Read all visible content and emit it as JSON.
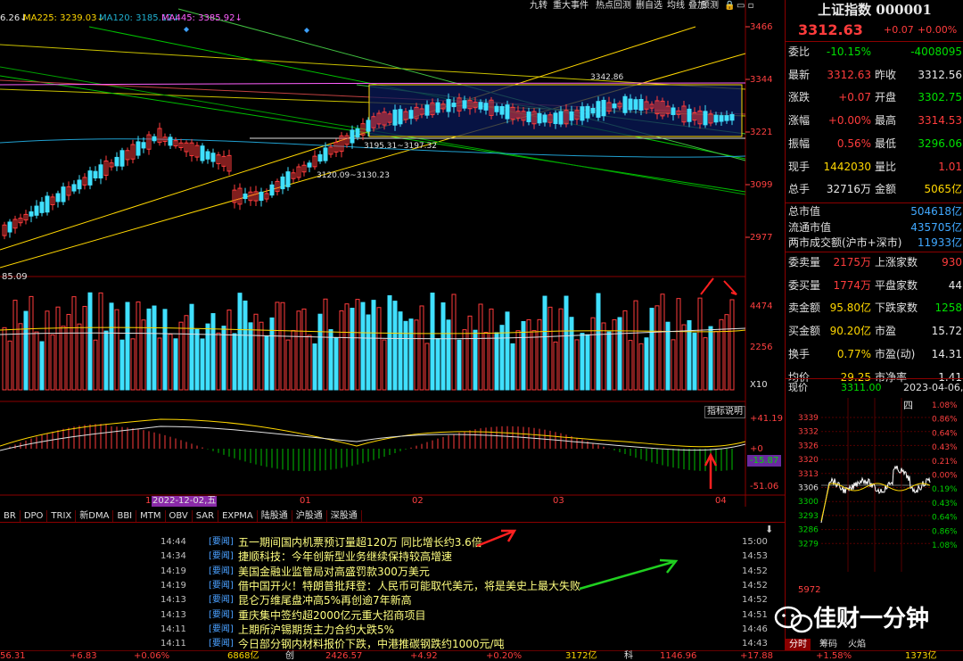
{
  "toolbar": {
    "buttons": [
      "九转",
      "重大事件",
      "热点回测",
      "删自选",
      "均线",
      "叠加",
      "预测"
    ]
  },
  "ma_legend": {
    "ma_first": "6.26↓",
    "ma225": "MA225: 3239.03↓",
    "ma120": "MA120: 3185.12↓",
    "ma445": "MA445: 3385.92↓"
  },
  "price_axis": [
    "3466",
    "3344",
    "3221",
    "3099",
    "2977"
  ],
  "annotations": {
    "high_label": "3342.86",
    "mid_label": "3195.31~3197.32",
    "low_label": "3120.09~3130.23",
    "left_low": "85.09"
  },
  "volume_axis": [
    "4474",
    "2256",
    "X10"
  ],
  "macd": {
    "button": "指标说明",
    "top": "+41.19",
    "zero": "+0",
    "value": "-15.87",
    "bottom": "-51.06"
  },
  "date_axis": {
    "selected": "2022-12-02,五",
    "marker": "1",
    "months": [
      "01",
      "02",
      "03",
      "04"
    ]
  },
  "indicator_tabs": [
    "BR",
    "DPO",
    "TRIX",
    "新DMA",
    "BBI",
    "MTM",
    "OBV",
    "SAR",
    "EXPMA",
    "陆股通",
    "沪股通",
    "深股通"
  ],
  "news": [
    {
      "time": "14:44",
      "tag": "[要闻]",
      "title": "五一期间国内机票预订量超120万 同比增长约3.6倍",
      "rtime": "15:00"
    },
    {
      "time": "14:34",
      "tag": "[要闻]",
      "title": "捷顺科技：今年创新型业务继续保持较高增速",
      "rtime": "14:53"
    },
    {
      "time": "14:19",
      "tag": "[要闻]",
      "title": "美国金融业监管局对高盛罚款300万美元",
      "rtime": "14:52"
    },
    {
      "time": "14:19",
      "tag": "[要闻]",
      "title": "借中国开火！特朗普批拜登：人民币可能取代美元，将是美史上最大失败",
      "rtime": "14:52"
    },
    {
      "time": "14:13",
      "tag": "[要闻]",
      "title": "昆仑万维尾盘冲高5%再创逾7年新高",
      "rtime": "14:52"
    },
    {
      "time": "14:13",
      "tag": "[要闻]",
      "title": "重庆集中签约超2000亿元重大招商项目",
      "rtime": "14:51"
    },
    {
      "time": "14:11",
      "tag": "[要闻]",
      "title": "上期所沪锡期货主力合约大跌5%",
      "rtime": "14:46"
    },
    {
      "time": "14:11",
      "tag": "[要闻]",
      "title": "今日部分钢内材料报价下跌，中港推碳钢跌约1000元/吨",
      "rtime": "14:43"
    }
  ],
  "quote": {
    "name": "上证指数 000001",
    "price": "3312.63",
    "change": "+0.07",
    "change_pct": "+0.00%",
    "rows": [
      {
        "l1": "委比",
        "v1": "-10.15%",
        "l2": "",
        "v2": "-4008095",
        "c1": "green",
        "c2": "green"
      },
      {
        "l1": "最新",
        "v1": "3312.63",
        "l2": "昨收",
        "v2": "3312.56",
        "c1": "red",
        "c2": "white"
      },
      {
        "l1": "涨跌",
        "v1": "+0.07",
        "l2": "开盘",
        "v2": "3302.75",
        "c1": "red",
        "c2": "green"
      },
      {
        "l1": "涨幅",
        "v1": "+0.00%",
        "l2": "最高",
        "v2": "3314.53",
        "c1": "red",
        "c2": "red"
      },
      {
        "l1": "振幅",
        "v1": "0.56%",
        "l2": "最低",
        "v2": "3296.06",
        "c1": "red",
        "c2": "green"
      },
      {
        "l1": "现手",
        "v1": "1442030",
        "l2": "量比",
        "v2": "1.01",
        "c1": "yellow",
        "c2": "red"
      },
      {
        "l1": "总手",
        "v1": "32716万",
        "l2": "金额",
        "v2": "5065亿",
        "c1": "white",
        "c2": "yellow"
      }
    ],
    "market": [
      {
        "l": "总市值",
        "v": "504618亿"
      },
      {
        "l": "流通市值",
        "v": "435705亿"
      },
      {
        "l": "两市成交额(沪市+深市)",
        "v": "11933亿"
      }
    ],
    "rows2": [
      {
        "l1": "委卖量",
        "v1": "2175万",
        "l2": "上涨家数",
        "v2": "930",
        "c1": "red",
        "c2": "red"
      },
      {
        "l1": "委买量",
        "v1": "1774万",
        "l2": "平盘家数",
        "v2": "44",
        "c1": "red",
        "c2": "white"
      },
      {
        "l1": "卖金额",
        "v1": "95.80亿",
        "l2": "下跌家数",
        "v2": "1258",
        "c1": "yellow",
        "c2": "green"
      },
      {
        "l1": "买金额",
        "v1": "90.20亿",
        "l2": "市盈",
        "v2": "15.72",
        "c1": "yellow",
        "c2": "white"
      },
      {
        "l1": "换手",
        "v1": "0.77%",
        "l2": "市盈(动)",
        "v2": "14.31",
        "c1": "yellow",
        "c2": "white"
      },
      {
        "l1": "均价",
        "v1": "29.25",
        "l2": "市净率",
        "v2": "1.41",
        "c1": "yellow",
        "c2": "white"
      }
    ],
    "current_label": "现价",
    "current_price": "3311.00",
    "current_date": "2023-04-06,四"
  },
  "mini_chart": {
    "left_axis": [
      "3339",
      "3332",
      "3326",
      "3320",
      "3313",
      "3306",
      "3300",
      "3293",
      "3286",
      "3279"
    ],
    "right_axis": [
      "1.08%",
      "0.86%",
      "0.64%",
      "0.43%",
      "0.21%",
      "0.00%",
      "0.19%",
      "0.43%",
      "0.64%",
      "0.86%",
      "1.08%"
    ],
    "vol": "5972",
    "tabs": [
      "分时",
      "筹码",
      "火焰"
    ]
  },
  "watermark": "佳财一分钟",
  "status_bar": [
    "56.31",
    "+6.83",
    "+0.06%",
    "6868亿",
    "创",
    "2426.57",
    "+4.92",
    "+0.20%",
    "3172亿",
    "科",
    "1146.96",
    "+17.88",
    "+1.58%",
    "1373亿"
  ]
}
